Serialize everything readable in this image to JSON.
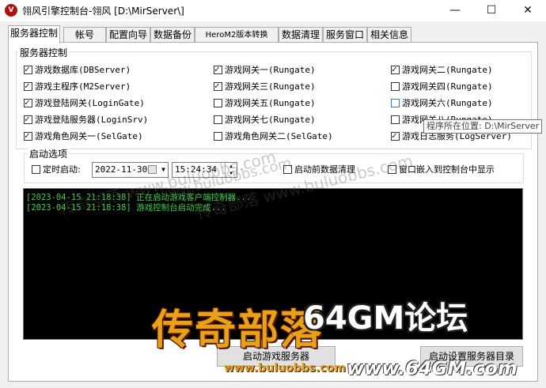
{
  "window": {
    "icon_glyph": "V",
    "title": "翎风引擎控制台-翎风 [D:\\MirServer\\]",
    "minimize_glyph": "—",
    "maximize_glyph": "☐",
    "close_glyph": "✕"
  },
  "tabs": [
    {
      "label": "服务器控制",
      "active": true
    },
    {
      "label": "帐号"
    },
    {
      "label": "配置向导"
    },
    {
      "label": "数据备份"
    },
    {
      "label": "HeroM2版本转换"
    },
    {
      "label": "数据清理"
    },
    {
      "label": "服务窗口"
    },
    {
      "label": "相关信息"
    }
  ],
  "server_control": {
    "group_title": "服务器控制",
    "col1": [
      {
        "label": "游戏数据库(DBServer)",
        "checked": true
      },
      {
        "label": "游戏主程序(M2Server)",
        "checked": true
      },
      {
        "label": "游戏登陆网关(LoginGate)",
        "checked": true
      },
      {
        "label": "游戏登陆服务器(LoginSrv)",
        "checked": true
      },
      {
        "label": "游戏角色网关一(SelGate)",
        "checked": true
      }
    ],
    "col2": [
      {
        "label": "游戏网关一(Rungate)",
        "checked": true
      },
      {
        "label": "游戏网关三(Rungate)",
        "checked": true
      },
      {
        "label": "游戏网关五(Rungate)",
        "checked": false
      },
      {
        "label": "游戏网关七(Rungate)",
        "checked": false
      },
      {
        "label": "游戏角色网关二(SelGate)",
        "checked": false
      }
    ],
    "col3": [
      {
        "label": "游戏网关二(Rungate)",
        "checked": true
      },
      {
        "label": "游戏网关四(Rungate)",
        "checked": false
      },
      {
        "label": "游戏网关六(Rungate)",
        "checked": false
      },
      {
        "label": "游戏网关八(Rungate)",
        "checked": false
      },
      {
        "label": "游戏日志服务(LogServer)",
        "checked": true
      }
    ]
  },
  "startup": {
    "group_title": "启动选项",
    "timed_start_label": "定时启动:",
    "timed_start_checked": false,
    "date_value": "2022-11-30",
    "time_value": "15:24:34",
    "clean_before_start_label": "启动前数据清理",
    "clean_before_start_checked": false,
    "embed_window_label": "窗口嵌入到控制台中显示",
    "embed_window_checked": false
  },
  "tooltip": "程序所在位置: D:\\MirServer",
  "log": [
    "[2023-04-15 21:18:38] 正在启动游戏客户端控制器...",
    "[2023-04-15 21:18:38] 游戏控制台启动完成..."
  ],
  "buttons": {
    "start_game_server": "启动游戏服务器",
    "start_setup_dir": "启动设置服务器目录"
  },
  "watermarks": {
    "wm1": "传奇部落 www.buluobbs.com",
    "wm2": "传奇部落 www.buluobbs.com",
    "wm3": "www.buluobbs.com",
    "logo": "传奇部落",
    "logo_url": "www.buluobbs.com",
    "gm_title": "64GM论坛",
    "gm_url": "www.64GM.com"
  },
  "colors": {
    "log_text": "#3fd34a",
    "console_bg": "#000000"
  }
}
